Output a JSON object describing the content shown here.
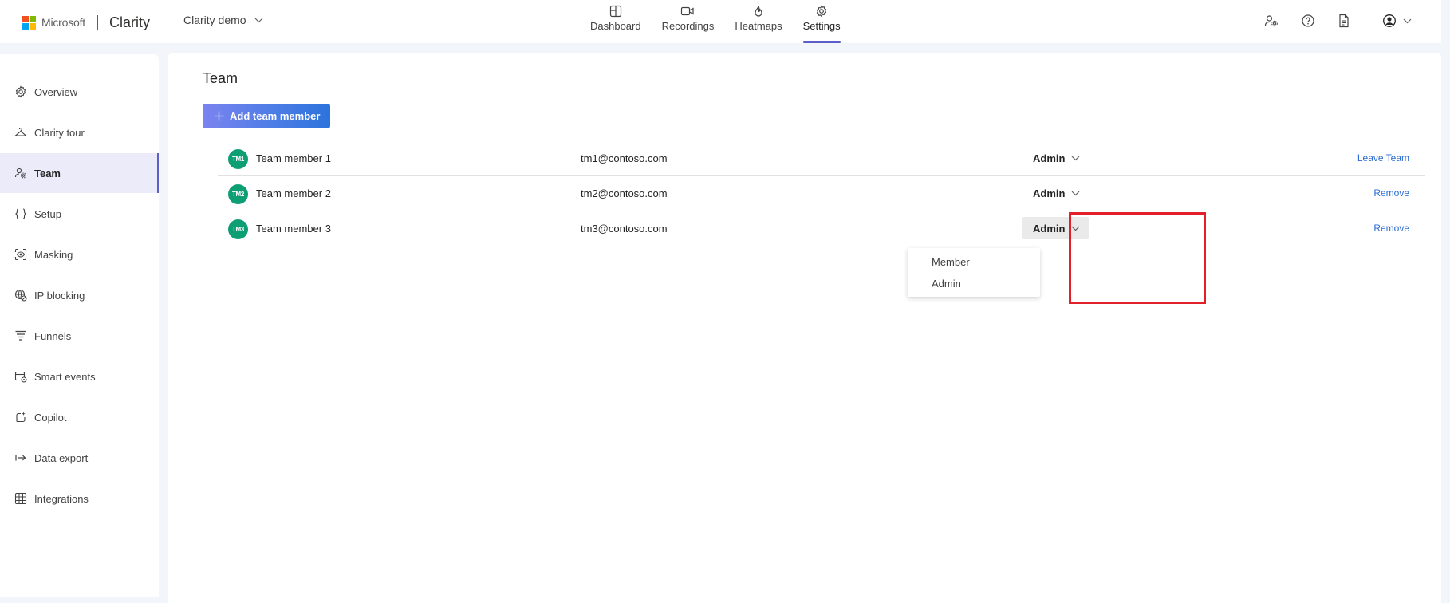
{
  "header": {
    "microsoft_text": "Microsoft",
    "app_name": "Clarity",
    "project_name": "Clarity demo",
    "logo_colors": [
      "#f25022",
      "#7fba00",
      "#00a4ef",
      "#ffb900"
    ],
    "nav": [
      {
        "label": "Dashboard",
        "icon": "dashboard-icon"
      },
      {
        "label": "Recordings",
        "icon": "video-icon"
      },
      {
        "label": "Heatmaps",
        "icon": "flame-icon"
      },
      {
        "label": "Settings",
        "icon": "gear-icon",
        "active": true
      }
    ],
    "right_icons": [
      "people-settings-icon",
      "help-icon",
      "document-icon",
      "profile-icon"
    ]
  },
  "sidebar": {
    "items": [
      {
        "label": "Overview",
        "icon": "gear-icon"
      },
      {
        "label": "Clarity tour",
        "icon": "hanger-icon"
      },
      {
        "label": "Team",
        "icon": "people-gear-icon",
        "active": true
      },
      {
        "label": "Setup",
        "icon": "braces-icon"
      },
      {
        "label": "Masking",
        "icon": "eye-mask-icon"
      },
      {
        "label": "IP blocking",
        "icon": "globe-block-icon"
      },
      {
        "label": "Funnels",
        "icon": "funnel-icon"
      },
      {
        "label": "Smart events",
        "icon": "calendar-gear-icon"
      },
      {
        "label": "Copilot",
        "icon": "copilot-icon"
      },
      {
        "label": "Data export",
        "icon": "export-arrow-icon"
      },
      {
        "label": "Integrations",
        "icon": "grid-icon"
      }
    ]
  },
  "main": {
    "title": "Team",
    "add_button_label": "Add team member",
    "members": [
      {
        "initials": "TM1",
        "name": "Team member 1",
        "email": "tm1@contoso.com",
        "role": "Admin",
        "action": "Leave Team"
      },
      {
        "initials": "TM2",
        "name": "Team member 2",
        "email": "tm2@contoso.com",
        "role": "Admin",
        "action": "Remove"
      },
      {
        "initials": "TM3",
        "name": "Team member 3",
        "email": "tm3@contoso.com",
        "role": "Admin",
        "action": "Remove"
      }
    ],
    "role_dropdown": {
      "options": [
        "Member",
        "Admin"
      ]
    }
  },
  "colors": {
    "accent": "#5b5fc7",
    "link": "#2b6cd3",
    "avatar": "#0d9e73",
    "highlight": "#e3202a"
  }
}
